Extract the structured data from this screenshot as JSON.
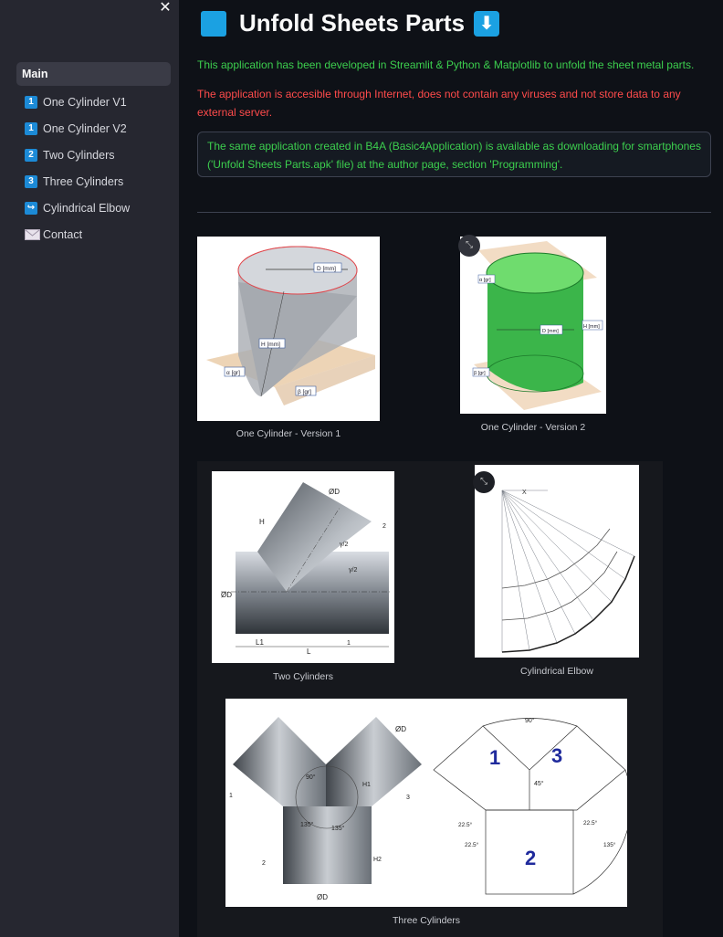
{
  "sidebar": {
    "close_icon": "✕",
    "items": [
      {
        "label": "Main",
        "badge": ""
      },
      {
        "label": "One Cylinder V1",
        "badge": "1"
      },
      {
        "label": "One Cylinder V2",
        "badge": "1"
      },
      {
        "label": "Two Cylinders",
        "badge": "2"
      },
      {
        "label": "Three Cylinders",
        "badge": "3"
      },
      {
        "label": "Cylindrical Elbow",
        "badge": "↪"
      },
      {
        "label": "Contact",
        "badge": ""
      }
    ]
  },
  "header": {
    "title": "Unfold Sheets Parts",
    "title_arrow": "⬇"
  },
  "content": {
    "intro": "This application has been developed in Streamlit & Python & Matplotlib to unfold the sheet metal parts.",
    "warning": "The application is accesible through Internet, does not contain any viruses and not store data to any external server.",
    "note": "The same application created in B4A (Basic4Application) is available as downloading for smartphones ('Unfold Sheets Parts.apk' file) at the author page, section 'Programming'."
  },
  "figures": {
    "one_cyl_v1": {
      "caption": "One Cylinder - Version 1",
      "labels": {
        "d": "D [mm]",
        "h": "H [mm]",
        "alpha": "α [gr]",
        "beta": "β [gr]"
      }
    },
    "one_cyl_v2": {
      "caption": "One Cylinder - Version 2",
      "labels": {
        "alpha": "α [gr]",
        "d": "D [mm]",
        "h": "H [mm]",
        "beta": "β [gr]"
      }
    },
    "two_cyl": {
      "caption": "Two Cylinders",
      "labels": {
        "od_top": "ØD",
        "h": "H",
        "n2": "2",
        "g2a": "γ/2",
        "g2b": "γ/2",
        "od_left": "ØD",
        "l1": "L1",
        "l": "L",
        "n1": "1"
      }
    },
    "elbow": {
      "caption": "Cylindrical Elbow",
      "labels": {
        "x": "X"
      }
    },
    "three_cyl": {
      "caption": "Three Cylinders",
      "labels": {
        "od_top": "ØD",
        "h1": "H1",
        "a90": "90°",
        "a135a": "135°",
        "a135b": "135°",
        "h2": "H2",
        "od_bottom": "ØD",
        "n1": "1",
        "n2": "2",
        "n3": "3",
        "big1": "1",
        "big2": "2",
        "big3": "3",
        "deg90": "90°",
        "deg45": "45°",
        "d225a": "22.5°",
        "d225b": "22.5°",
        "d225c": "22.5°",
        "d135": "135°"
      }
    }
  },
  "colors": {
    "green_text": "#3ccf4e",
    "red_text": "#ff4b4b",
    "accent": "#1ba1e2"
  }
}
